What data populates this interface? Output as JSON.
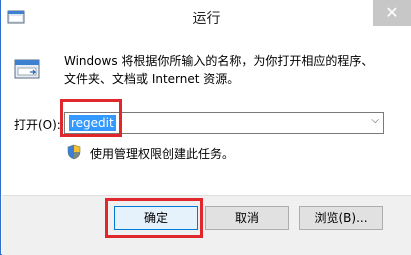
{
  "window": {
    "title": "运行",
    "close_glyph": "✕"
  },
  "dialog": {
    "description_line1": "Windows 将根据你所输入的名称，为你打开相应的程序、",
    "description_line2": "文件夹、文档或 Internet 资源。",
    "open_label": "打开(O):",
    "open_value": "regedit",
    "admin_note": "使用管理权限创建此任务。"
  },
  "buttons": {
    "ok": "确定",
    "cancel": "取消",
    "browse": "浏览(B)..."
  },
  "icons": {
    "app": "run-app-icon",
    "run": "run-dialog-icon",
    "shield": "uac-shield-icon"
  },
  "colors": {
    "highlight": "#e0282c",
    "selection": "#3399ff"
  }
}
